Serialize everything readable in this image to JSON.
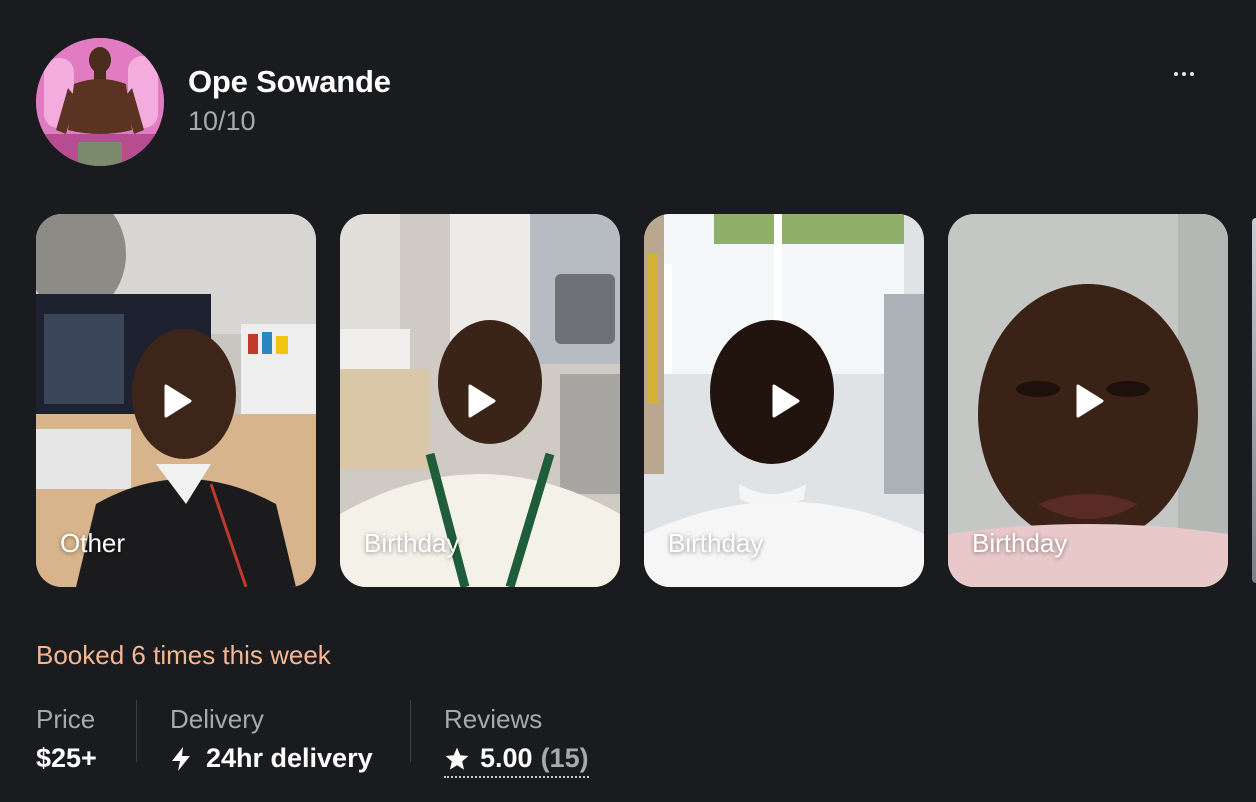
{
  "profile": {
    "name": "Ope Sowande",
    "subtitle": "10/10",
    "more_icon": "more-horizontal-icon"
  },
  "videos": [
    {
      "label": "Other",
      "icon": "play-icon"
    },
    {
      "label": "Birthday",
      "icon": "play-icon"
    },
    {
      "label": "Birthday",
      "icon": "play-icon"
    },
    {
      "label": "Birthday",
      "icon": "play-icon"
    }
  ],
  "booked_text": "Booked 6 times this week",
  "stats": {
    "price": {
      "label": "Price",
      "value": "$25+"
    },
    "delivery": {
      "label": "Delivery",
      "value": "24hr delivery",
      "icon": "lightning-bolt-icon"
    },
    "reviews": {
      "label": "Reviews",
      "value": "5.00",
      "count": "(15)",
      "icon": "star-icon"
    }
  },
  "colors": {
    "background": "#1a1b1e",
    "accent_booked": "#f5b692",
    "muted_text": "#a7a9ad"
  }
}
